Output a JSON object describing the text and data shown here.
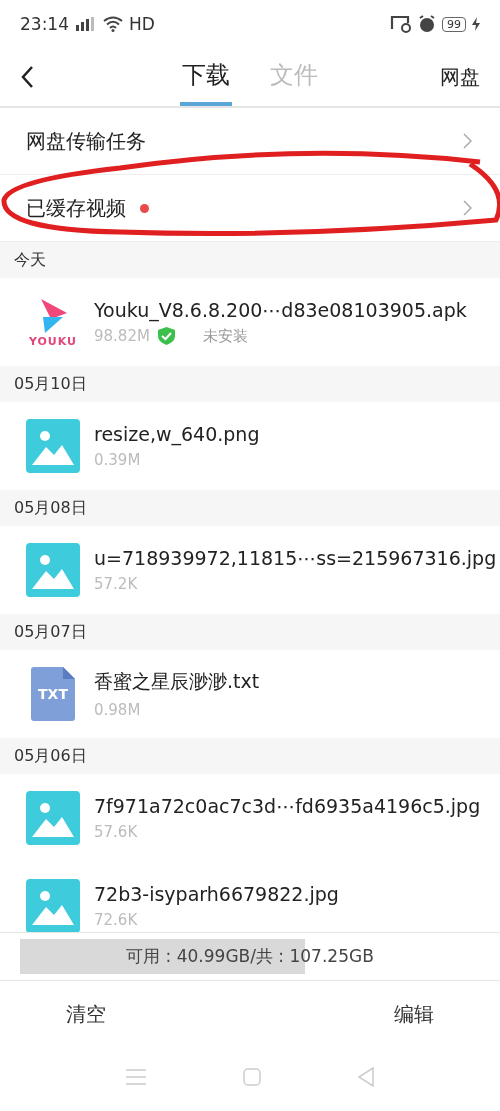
{
  "status_bar": {
    "time": "23:14",
    "network": "HD",
    "battery": "99"
  },
  "header": {
    "tabs": [
      {
        "label": "下载",
        "selected": true
      },
      {
        "label": "文件",
        "selected": false
      }
    ],
    "action": "网盘"
  },
  "links": [
    {
      "label": "网盘传输任务",
      "dot": false
    },
    {
      "label": "已缓存视频",
      "dot": true
    }
  ],
  "sections": [
    {
      "date": "今天",
      "files": [
        {
          "kind": "app",
          "name": "Youku_V8.6.8.200⋯d83e08103905.apk",
          "size": "98.82M",
          "verified": true,
          "status": "未安装",
          "logo_text": "YOUKU"
        }
      ]
    },
    {
      "date": "05月10日",
      "files": [
        {
          "kind": "image",
          "name": "resize,w_640.png",
          "size": "0.39M"
        }
      ]
    },
    {
      "date": "05月08日",
      "files": [
        {
          "kind": "image",
          "name": "u=718939972,11815⋯ss=215967316.jpg",
          "size": "57.2K"
        }
      ]
    },
    {
      "date": "05月07日",
      "files": [
        {
          "kind": "text",
          "name": "香蜜之星辰渺渺.txt",
          "size": "0.98M",
          "badge": "TXT"
        }
      ]
    },
    {
      "date": "05月06日",
      "files": [
        {
          "kind": "image",
          "name": "7f971a72c0ac7c3d⋯fd6935a4196c5.jpg",
          "size": "57.6K"
        },
        {
          "kind": "image",
          "name": "72b3-isyparh6679822.jpg",
          "size": "72.6K"
        }
      ]
    }
  ],
  "storage": {
    "label": "可用 : 40.99GB/共 : 107.25GB",
    "level": 0.62
  },
  "footer": {
    "buttons": [
      "清空",
      "编辑"
    ]
  }
}
